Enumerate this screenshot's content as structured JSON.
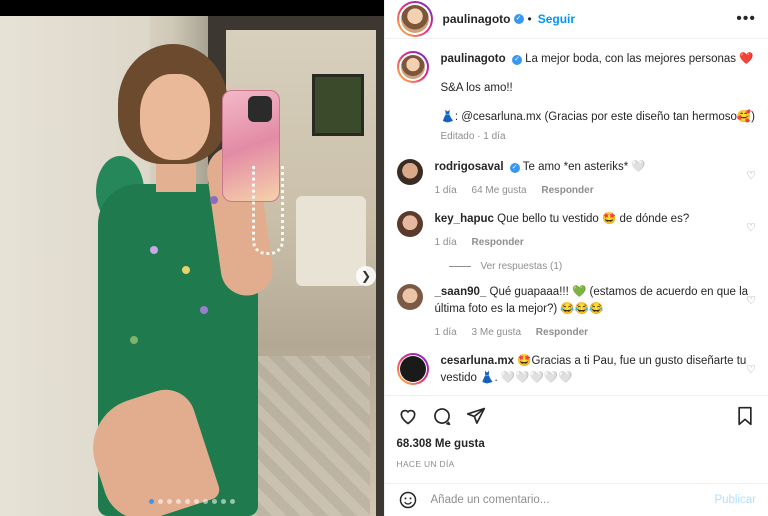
{
  "header": {
    "username": "paulinagoto",
    "follow": "Seguir",
    "more": "•••"
  },
  "caption": {
    "username": "paulinagoto",
    "line1": "La mejor boda, con las mejores personas ❤️",
    "line2": "S&A los amo!!",
    "line3": "👗: @cesarluna.mx (Gracias por este diseño tan hermoso🥰)",
    "meta": "Editado · 1 día"
  },
  "comments": [
    {
      "username": "rodrigosaval",
      "text": "Te amo *en asteriks* 🤍",
      "time": "1 día",
      "likes": "64 Me gusta",
      "reply": "Responder",
      "verified": true
    },
    {
      "username": "key_hapuc",
      "text": "Que bello tu vestido 🤩 de dónde es?",
      "time": "1 día",
      "likes": "",
      "reply": "Responder",
      "replies": "Ver respuestas (1)"
    },
    {
      "username": "_saan90_",
      "text": "Qué guapaaa!!! 💚 (estamos de acuerdo en que la última foto es la mejor?) 😂😂😂",
      "time": "1 día",
      "likes": "3 Me gusta",
      "reply": "Responder"
    },
    {
      "username": "cesarluna.mx",
      "text": "🤩Gracias a ti Pau, fue un gusto diseñarte tu vestido 👗. 🤍🤍🤍🤍🤍",
      "time": "",
      "likes": "",
      "reply": ""
    }
  ],
  "stats": {
    "likes": "68.308 Me gusta",
    "time": "HACE UN DÍA"
  },
  "add_comment": {
    "placeholder": "Añade un comentario...",
    "publish": "Publicar"
  },
  "icons": {
    "like": "heart-icon",
    "comment": "comment-icon",
    "share": "share-icon",
    "save": "bookmark-icon",
    "emoji": "emoji-icon",
    "next": "chevron-right-icon"
  },
  "colors": {
    "accent": "#0095f6",
    "verified": "#3897f0",
    "muted": "#8e8e8e",
    "dress": "#1f7a4d"
  },
  "carousel": {
    "count": 10,
    "active_index": 0
  }
}
